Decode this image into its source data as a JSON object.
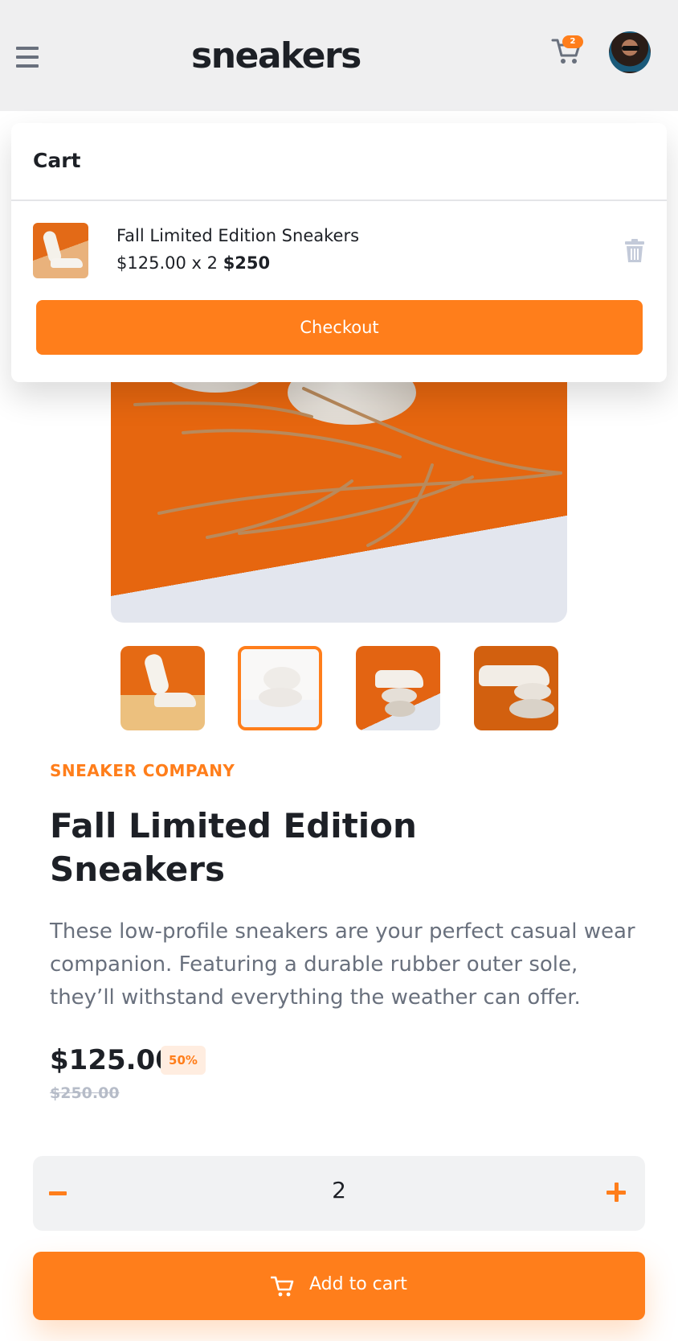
{
  "header": {
    "logo": "sneakers",
    "cart_count": "2",
    "icons": {
      "menu": "menu-icon",
      "cart": "cart-icon",
      "avatar": "avatar"
    }
  },
  "cart": {
    "title": "Cart",
    "items": [
      {
        "name": "Fall Limited Edition Sneakers",
        "unit_price": "$125.00",
        "multiplier": "x 2",
        "total": "$250"
      }
    ],
    "checkout_label": "Checkout",
    "delete_icon": "trash-icon"
  },
  "gallery": {
    "thumbnail_count": 4,
    "active_index": 1
  },
  "product": {
    "company": "SNEAKER COMPANY",
    "title": "Fall Limited Edition Sneakers",
    "description": "These low-profile sneakers are your perfect casual wear companion. Featuring a durable rubber outer sole, they’ll withstand everything the weather can offer.",
    "price": "$125.00",
    "discount": "50%",
    "original_price": "$250.00"
  },
  "quantity": {
    "value": "2",
    "minus_icon": "minus-icon",
    "plus_icon": "plus-icon"
  },
  "add_to_cart": {
    "label": "Add to cart"
  },
  "colors": {
    "accent": "#ff7e1b",
    "text_dark": "#1d2026",
    "text_gray": "#69707d",
    "header_bg": "#efeff0"
  }
}
